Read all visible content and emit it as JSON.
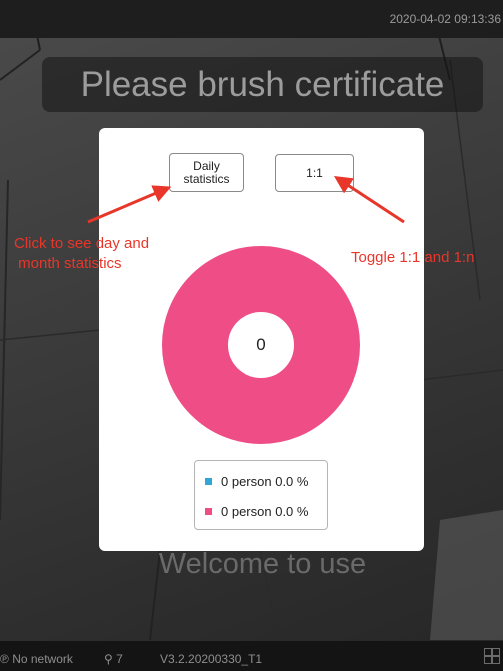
{
  "header": {
    "datetime": "2020-04-02 09:13:36"
  },
  "prompt": {
    "text": "Please brush certificate"
  },
  "stats_panel": {
    "daily_button_label": "Daily statistics",
    "mode_button_label": "1:1",
    "center_label": "0",
    "legend": [
      {
        "count_label": "0 person",
        "percent_label": "0.0 %",
        "color": "#2fa6d6"
      },
      {
        "count_label": "0 person",
        "percent_label": "0.0 %",
        "color": "#ee4d85"
      }
    ],
    "donut_color": "#ee4d85"
  },
  "annotations": {
    "left": "Click to see day and\n month statistics",
    "right": "Toggle 1:1 and 1:n"
  },
  "welcome": {
    "text": "Welcome to use"
  },
  "footer": {
    "network_status": "No network",
    "user_count": "7",
    "version": "V3.2.20200330_T1"
  },
  "colors": {
    "annotation": "#e8362a",
    "accent_pink": "#ee4d85",
    "accent_blue": "#2fa6d6"
  },
  "icons": {
    "network": "network-icon",
    "user": "person-icon",
    "grid": "grid-icon"
  }
}
